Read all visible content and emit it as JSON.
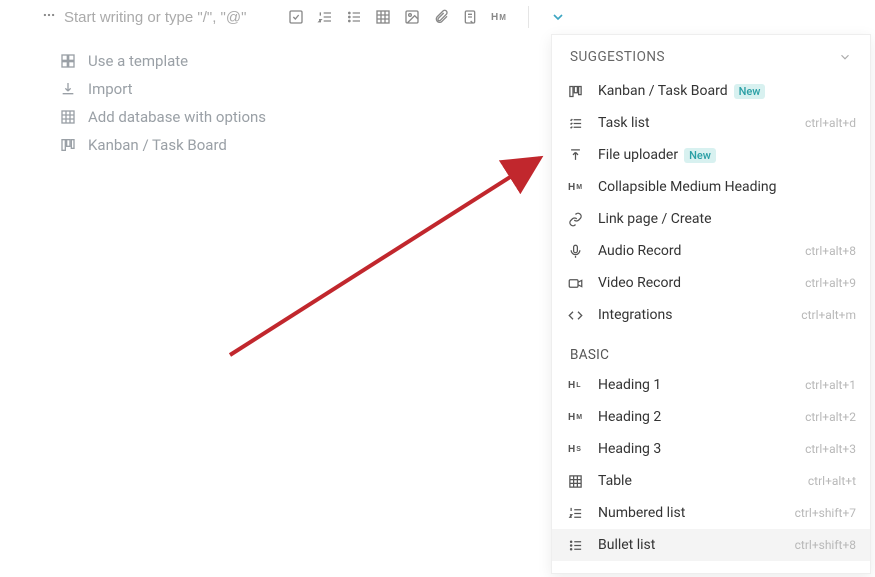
{
  "toolbar": {
    "placeholder": "Start writing or type \"/\", \"@\""
  },
  "quick": [
    {
      "label": "Use a template",
      "icon": "template"
    },
    {
      "label": "Import",
      "icon": "import"
    },
    {
      "label": "Add database with options",
      "icon": "table"
    },
    {
      "label": "Kanban / Task Board",
      "icon": "columns"
    }
  ],
  "dropdown": {
    "header": "SUGGESTIONS",
    "basic_header": "BASIC",
    "new_badge": "New",
    "suggestions": [
      {
        "label": "Kanban / Task Board",
        "icon": "columns",
        "shortcut": "",
        "isNew": true
      },
      {
        "label": "Task list",
        "icon": "tasklist",
        "shortcut": "ctrl+alt+d",
        "isNew": false
      },
      {
        "label": "File uploader",
        "icon": "upload",
        "shortcut": "",
        "isNew": true
      },
      {
        "label": "Collapsible Medium Heading",
        "icon": "hm",
        "shortcut": "",
        "isNew": false
      },
      {
        "label": "Link page / Create",
        "icon": "link",
        "shortcut": "",
        "isNew": false
      },
      {
        "label": "Audio Record",
        "icon": "mic",
        "shortcut": "ctrl+alt+8",
        "isNew": false
      },
      {
        "label": "Video Record",
        "icon": "video",
        "shortcut": "ctrl+alt+9",
        "isNew": false
      },
      {
        "label": "Integrations",
        "icon": "code",
        "shortcut": "ctrl+alt+m",
        "isNew": false
      }
    ],
    "basic": [
      {
        "label": "Heading 1",
        "icon": "hl",
        "shortcut": "ctrl+alt+1"
      },
      {
        "label": "Heading 2",
        "icon": "hm",
        "shortcut": "ctrl+alt+2"
      },
      {
        "label": "Heading 3",
        "icon": "hs",
        "shortcut": "ctrl+alt+3"
      },
      {
        "label": "Table",
        "icon": "table",
        "shortcut": "ctrl+alt+t"
      },
      {
        "label": "Numbered list",
        "icon": "numlist",
        "shortcut": "ctrl+shift+7"
      },
      {
        "label": "Bullet list",
        "icon": "bullets",
        "shortcut": "ctrl+shift+8",
        "highlight": true
      }
    ]
  }
}
